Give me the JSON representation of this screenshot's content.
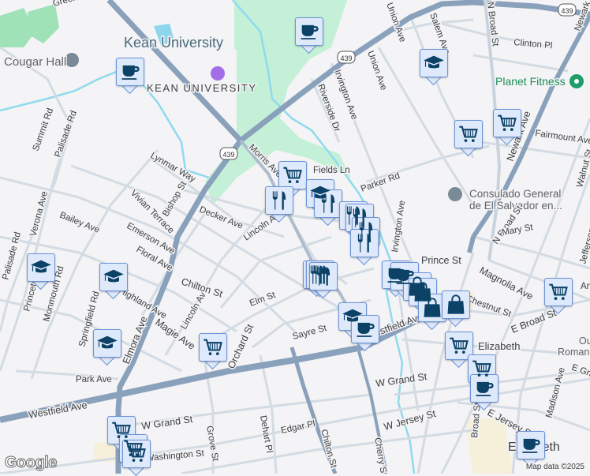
{
  "map": {
    "places": {
      "kean_university": "Kean University",
      "kean_university_campus": "KEAN UNIVERSITY",
      "cougar_hall": "Cougar Hall",
      "planet_fitness": "Planet Fitness",
      "consulado_line1": "Consulado General",
      "consulado_line2": "de El Salvador en...",
      "elizabeth_station": "Elizabeth",
      "elizabeth_city": "Elizabeth",
      "our_roman": "Our",
      "our_roman2": "Roman"
    },
    "streets": {
      "greenway": "Green",
      "morris_ave": "Morris Ave",
      "lynmar_way": "Lynmar Way",
      "bishop_st": "Bishop St",
      "vivian_terrace": "Vivian Terrace",
      "decker_ave": "Decker Ave",
      "lincoln_ave": "Lincoln Ave",
      "lincoln_ave_s": "Lincoln Ave",
      "summit_rd": "Summit Rd",
      "palisade_rd": "Palisade Rd",
      "palisade_rd_s": "Palisade Rd",
      "verona_ave": "Verona Ave",
      "bailey_ave": "Bailey Ave",
      "emerson_ave": "Emerson Ave",
      "floral_ave": "Floral Ave",
      "chilton_st": "Chilton St",
      "chilton_st_s": "Chilton St",
      "princeton": "Princeton",
      "monmouth_rd": "Monmouth Rd",
      "highland_ave": "Highland Ave",
      "springfield_rd": "Springfield Rd",
      "elmora_ave": "Elmora Ave",
      "magie_ave": "Magie Ave",
      "orchard_st": "Orchard St",
      "elm_st": "Elm St",
      "sayre_st": "Sayre St",
      "park_ave": "Park Ave",
      "westfield_ave": "Westfield Ave",
      "westfield_ave_e": "Westfield Ave",
      "w_grand_st": "W Grand St",
      "w_grand_st_w": "W Grand St",
      "grove_st": "Grove St",
      "dehart_pl": "Dehart Pl",
      "edgar_pl": "Edgar Pl",
      "washington_st": "Washington St",
      "w_jersey_st": "W Jersey St",
      "cherry_st": "Cherry St",
      "union_ave": "Union Ave",
      "irvington_ave": "Irvington Ave",
      "irvington_ave_s": "Irvington Ave",
      "riverside_dr": "Riverside Dr",
      "salem_ave": "Salem Ave",
      "n_broad_st": "N Broad St",
      "n_broad_st_s": "N Broad St",
      "clinton_pl": "Clinton Pl",
      "newark_ave": "Newark Ave",
      "newark_ave_n": "Newark Ave",
      "fairmount_ave": "Fairmount Ave",
      "walnut_st": "Walnut St",
      "parker_rd": "Parker Rd",
      "mary_st": "Mary St",
      "prince_st": "Prince St",
      "magnolia_ave": "Magnolia Ave",
      "chestnut_st": "Chestnut St",
      "e_broad_st": "E Broad St",
      "e_grand_st": "E Gra",
      "madison_ave": "Madison Ave",
      "e_jersey_st": "E Jersey St",
      "broad_st": "Broad St",
      "jefferson_ave": "Jefferson Ave",
      "anna_st": "Ann",
      "fields_ln": "Fields Ln",
      "upper_ave": "Union Ave"
    },
    "route_shield": "439",
    "attribution": "Map data ©2025",
    "logo": "Google",
    "colors": {
      "marker_fill": "#dfe9fc",
      "marker_border": "#6b93d6",
      "marker_icon": "#0b4266",
      "major_road": "#8aa1bc",
      "park": "#c3f0d6",
      "water": "#7fd3ea"
    },
    "markers": [
      {
        "type": "coffee"
      },
      {
        "type": "coffee"
      },
      {
        "type": "school"
      },
      {
        "type": "cart"
      },
      {
        "type": "cart"
      }
    ]
  }
}
